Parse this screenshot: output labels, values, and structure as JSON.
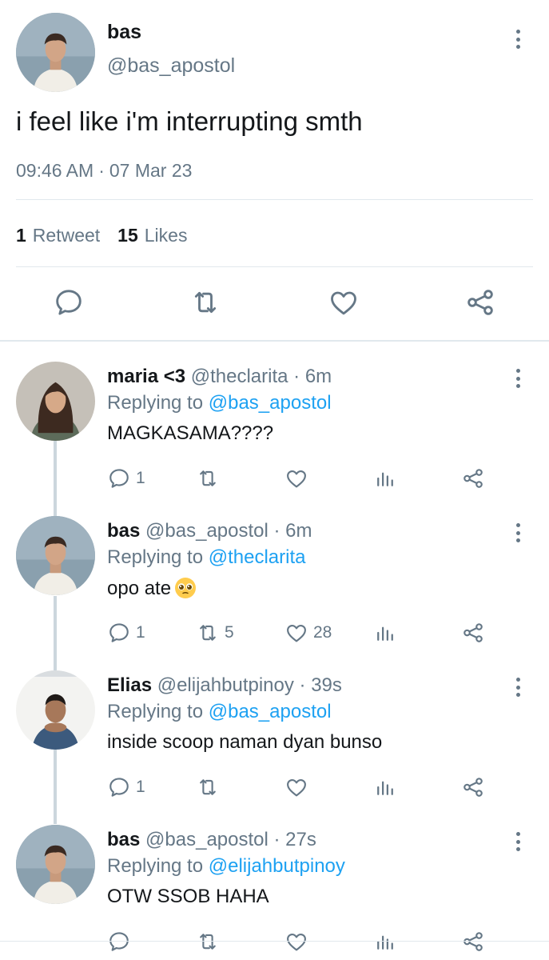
{
  "main_tweet": {
    "name": "bas",
    "handle": "@bas_apostol",
    "text": "i feel like i'm interrupting smth",
    "time": "09:46 AM",
    "date": "07 Mar 23",
    "time_separator": "·",
    "retweets_count": "1",
    "retweets_label": "Retweet",
    "likes_count": "15",
    "likes_label": "Likes"
  },
  "replies": [
    {
      "name": "maria <3",
      "handle": "@theclarita",
      "age": "· 6m",
      "replying_prefix": "Replying to",
      "mention": "@bas_apostol",
      "text": "MAGKASAMA????",
      "reply_count": "1",
      "retweet_count": "",
      "like_count": ""
    },
    {
      "name": "bas",
      "handle": "@bas_apostol",
      "age": "· 6m",
      "replying_prefix": "Replying to",
      "mention": "@theclarita",
      "text": "opo ate",
      "emoji": "pleading-face-emoji",
      "reply_count": "1",
      "retweet_count": "5",
      "like_count": "28"
    },
    {
      "name": "Elias",
      "handle": "@elijahbutpinoy",
      "age": "· 39s",
      "replying_prefix": "Replying to",
      "mention": "@bas_apostol",
      "text": "inside scoop naman dyan bunso",
      "reply_count": "1",
      "retweet_count": "",
      "like_count": ""
    },
    {
      "name": "bas",
      "handle": "@bas_apostol",
      "age": "· 27s",
      "replying_prefix": "Replying to",
      "mention": "@elijahbutpinoy",
      "text": "OTW SSOB HAHA",
      "reply_count": "",
      "retweet_count": "",
      "like_count": ""
    }
  ],
  "icons": {
    "reply": "reply-icon",
    "retweet": "retweet-icon",
    "like": "heart-icon",
    "analytics": "analytics-icon",
    "share": "share-icon",
    "more": "more-vertical-icon"
  },
  "colors": {
    "text": "#14171a",
    "secondary": "#657786",
    "link": "#1da1f2",
    "divider": "#e1e8ed",
    "thread_line": "#ccd6dd"
  }
}
